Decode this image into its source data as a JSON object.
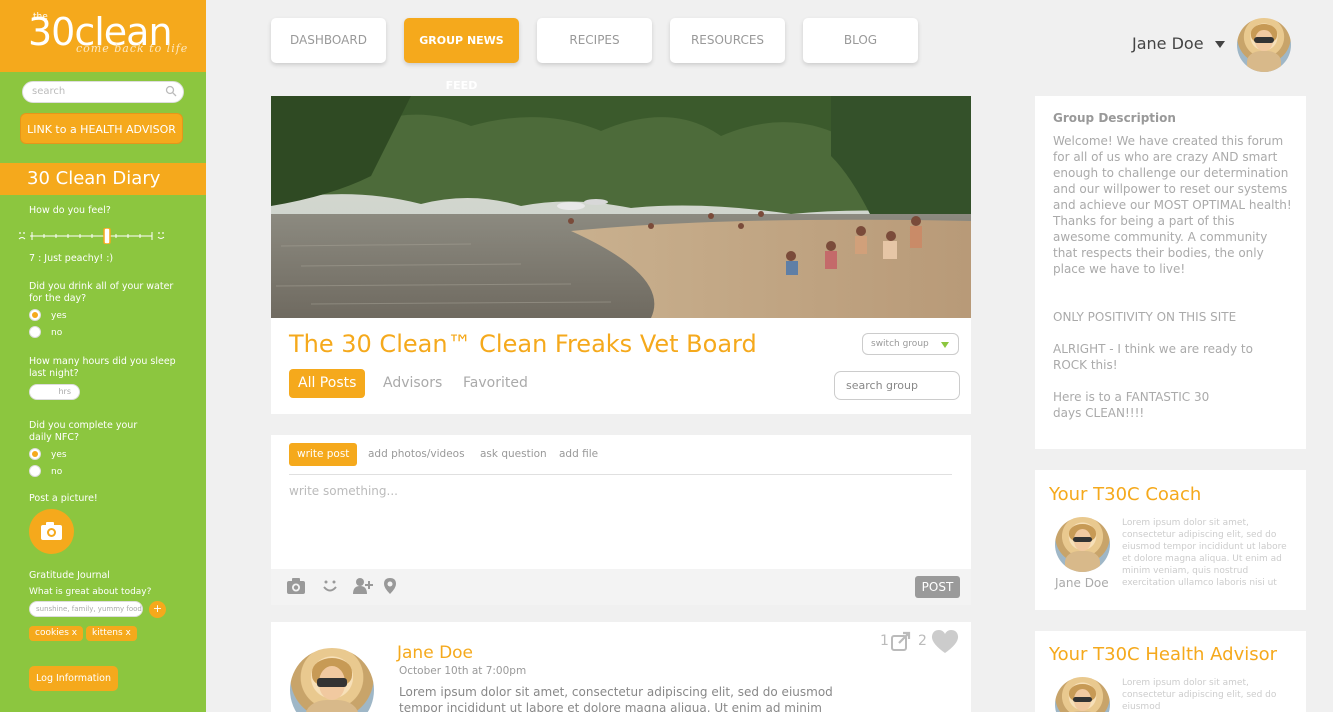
{
  "sidebar": {
    "logo": {
      "small": "the",
      "main": "30clean",
      "tagline": "come back to life"
    },
    "search_placeholder": "search",
    "link_button": "LINK to a HEALTH ADVISOR",
    "diary_title": "30 Clean Diary",
    "feel_question": "How do you feel?",
    "feel_level": 0.8,
    "feel_value": "7 : Just peachy! :)",
    "water_question": "Did you drink all of your water for the day?",
    "water_options": [
      "yes",
      "no"
    ],
    "water_selected": "yes",
    "sleep_question": "How many hours did you sleep last night?",
    "sleep_placeholder": "hrs",
    "nfc_question": "Did you complete your daily NFC?",
    "nfc_options": [
      "yes",
      "no"
    ],
    "nfc_selected": "yes",
    "picture_label": "Post a picture!",
    "gratitude_title": "Gratitude Journal",
    "gratitude_question": "What is great about today?",
    "gratitude_placeholder": "sunshine, family, yummy food...",
    "gratitude_add": "+",
    "tags": [
      "cookies x",
      "kittens x"
    ],
    "log_button": "Log Information"
  },
  "nav": {
    "items": [
      "DASHBOARD",
      "GROUP NEWS FEED",
      "RECIPES",
      "RESOURCES",
      "BLOG"
    ],
    "active": "GROUP NEWS FEED"
  },
  "user": {
    "name": "Jane Doe"
  },
  "group": {
    "title": "The 30 Clean™ Clean Freaks Vet Board",
    "switch_label": "switch group",
    "tabs": [
      "All Posts",
      "Advisors",
      "Favorited"
    ],
    "active_tab": "All Posts",
    "search_placeholder": "search group"
  },
  "composer": {
    "tabs": [
      "write post",
      "add photos/videos",
      "ask question",
      "add file"
    ],
    "active_tab": "write post",
    "placeholder": "write something...",
    "post_button": "POST",
    "tools": [
      "camera-icon",
      "smiley-icon",
      "add-person-icon",
      "location-icon"
    ]
  },
  "feed": {
    "post": {
      "author": "Jane Doe",
      "date": "October 10th at 7:00pm",
      "text": "Lorem ipsum dolor sit amet, consectetur adipiscing elit, sed do eiusmod tempor incididunt ut labore et dolore magna aliqua. Ut enim ad minim veniam, quis nostrud",
      "shares": "1",
      "likes": "2"
    }
  },
  "right": {
    "description": {
      "heading": "Group Description",
      "paragraphs": [
        "Welcome! We have created this forum for all of us who are crazy AND smart enough to challenge our determination and our willpower to reset our systems and achieve our MOST OPTIMAL health! Thanks for being a part of this awesome community. A community that respects their bodies, the only place we have to live!",
        "ONLY POSITIVITY ON THIS SITE",
        "ALRIGHT - I think we are ready to ROCK this!",
        "Here is to a FANTASTIC 30 days CLEAN!!!!"
      ]
    },
    "coach": {
      "title": "Your T30C Coach",
      "name": "Jane Doe",
      "text": "Lorem ipsum dolor sit amet, consectetur adipiscing elit, sed do eiusmod tempor incididunt ut labore et dolore magna aliqua. Ut enim ad minim veniam, quis nostrud exercitation ullamco laboris nisi ut"
    },
    "advisor": {
      "title": "Your T30C Health Advisor",
      "text": "Lorem ipsum dolor sit amet, consectetur adipiscing elit, sed do eiusmod"
    }
  },
  "colors": {
    "accent": "#f5a91c",
    "sidebar": "#8cc63f",
    "background": "#f0f0f0"
  }
}
